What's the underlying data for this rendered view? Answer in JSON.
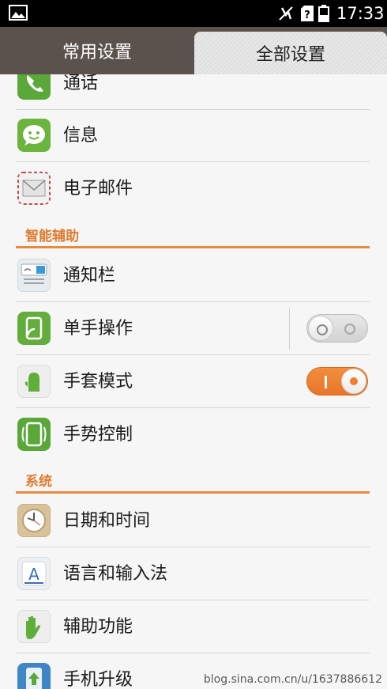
{
  "status_bar": {
    "time": "17:33"
  },
  "tabs": [
    {
      "label": "常用设置",
      "selected": false
    },
    {
      "label": "全部设置",
      "selected": true
    }
  ],
  "items": {
    "call": "通话",
    "messages": "信息",
    "email": "电子邮件",
    "notification_bar": "通知栏",
    "one_hand": "单手操作",
    "glove_mode": "手套模式",
    "gesture_control": "手势控制",
    "date_time": "日期和时间",
    "language_input": "语言和输入法",
    "accessibility": "辅助功能",
    "system_update": "手机升级"
  },
  "sections": {
    "smart_assist": "智能辅助",
    "system": "系统"
  },
  "toggles": {
    "one_hand_enabled": false,
    "glove_mode_enabled": true
  },
  "watermark": "blog.sina.com.cn/u/1637886612",
  "colors": {
    "accent": "#e88a3c",
    "tab_bar": "#5a524d"
  }
}
